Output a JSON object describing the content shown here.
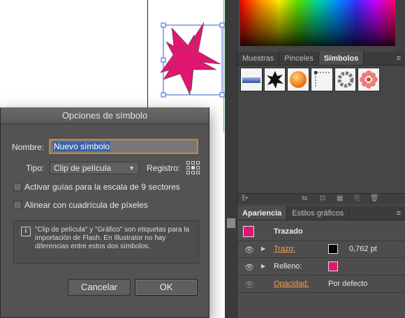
{
  "dialog": {
    "title": "Opciones de símbolo",
    "name_label": "Nombre:",
    "name_value": "Nuevo símbolo",
    "type_label": "Tipo:",
    "type_value": "Clip de película",
    "registration_label": "Registro:",
    "checkbox_9slice": "Activar guías para la escala de 9 sectores",
    "checkbox_pixel_grid": "Alinear con cuadrícula de píxeles",
    "info_text": "\"Clip de película\" y \"Gráfico\" son etiquetas para la importación de Flash. En Illustrator no hay diferencias entre estos dos símbolos.",
    "cancel_label": "Cancelar",
    "ok_label": "OK"
  },
  "panels": {
    "symbols_tabs": [
      "Muestras",
      "Pinceles",
      "Símbolos"
    ],
    "symbols_active": "Símbolos",
    "appearance_tabs": [
      "Apariencia",
      "Estilos gráficos"
    ],
    "appearance_active": "Apariencia",
    "appearance": {
      "header": "Trazado",
      "stroke_label": "Trazo:",
      "stroke_value": "0,762 pt",
      "stroke_color": "#000000",
      "fill_label": "Relleno:",
      "fill_color": "#e0166f",
      "opacity_label": "Opacidad:",
      "opacity_value": "Por defecto"
    }
  },
  "colors": {
    "artwork_fill": "#e0166f",
    "selection": "#2f5fd0",
    "guide": "#39d353",
    "accent_label": "#f0a04a"
  }
}
